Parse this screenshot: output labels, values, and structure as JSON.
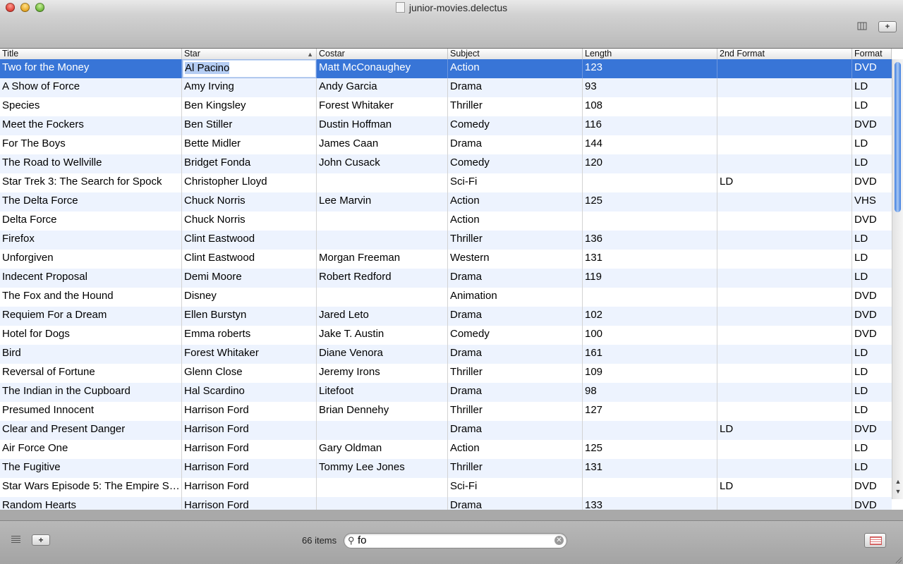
{
  "window": {
    "title": "junior-movies.delectus"
  },
  "toolbar": {
    "columns_icon": "columns-icon",
    "add_label": "+"
  },
  "table": {
    "columns": [
      "Title",
      "Star",
      "Costar",
      "Subject",
      "Length",
      "2nd Format",
      "Format"
    ],
    "sort_column": "Star",
    "sort_direction": "ascending",
    "editing_cell": {
      "row": 0,
      "column": "Star"
    },
    "rows": [
      [
        "Two for the Money",
        "Al Pacino",
        "Matt McConaughey",
        "Action",
        "123",
        "",
        "DVD"
      ],
      [
        "A Show of Force",
        "Amy Irving",
        "Andy Garcia",
        "Drama",
        "93",
        "",
        "LD"
      ],
      [
        "Species",
        "Ben Kingsley",
        "Forest Whitaker",
        "Thriller",
        "108",
        "",
        "LD"
      ],
      [
        "Meet the Fockers",
        "Ben Stiller",
        "Dustin Hoffman",
        "Comedy",
        "116",
        "",
        "DVD"
      ],
      [
        "For The Boys",
        "Bette Midler",
        "James Caan",
        "Drama",
        "144",
        "",
        "LD"
      ],
      [
        "The Road to Wellville",
        "Bridget Fonda",
        "John Cusack",
        "Comedy",
        "120",
        "",
        "LD"
      ],
      [
        "Star Trek 3: The Search for Spock",
        "Christopher Lloyd",
        "",
        "Sci-Fi",
        "",
        "LD",
        "DVD"
      ],
      [
        "The Delta Force",
        "Chuck Norris",
        "Lee Marvin",
        "Action",
        "125",
        "",
        "VHS"
      ],
      [
        "Delta Force",
        "Chuck Norris",
        "",
        "Action",
        "",
        "",
        "DVD"
      ],
      [
        "Firefox",
        "Clint Eastwood",
        "",
        "Thriller",
        "136",
        "",
        "LD"
      ],
      [
        "Unforgiven",
        "Clint Eastwood",
        "Morgan Freeman",
        "Western",
        "131",
        "",
        "LD"
      ],
      [
        "Indecent Proposal",
        "Demi Moore",
        "Robert Redford",
        "Drama",
        "119",
        "",
        "LD"
      ],
      [
        "The Fox and the Hound",
        "Disney",
        "",
        "Animation",
        "",
        "",
        "DVD"
      ],
      [
        "Requiem For a Dream",
        "Ellen Burstyn",
        "Jared Leto",
        "Drama",
        "102",
        "",
        "DVD"
      ],
      [
        "Hotel for Dogs",
        "Emma roberts",
        "Jake T. Austin",
        "Comedy",
        "100",
        "",
        "DVD"
      ],
      [
        "Bird",
        "Forest Whitaker",
        "Diane Venora",
        "Drama",
        "161",
        "",
        "LD"
      ],
      [
        "Reversal of Fortune",
        "Glenn Close",
        "Jeremy Irons",
        "Thriller",
        "109",
        "",
        "LD"
      ],
      [
        "The Indian in the Cupboard",
        "Hal Scardino",
        "Litefoot",
        "Drama",
        "98",
        "",
        "LD"
      ],
      [
        "Presumed Innocent",
        "Harrison Ford",
        "Brian Dennehy",
        "Thriller",
        "127",
        "",
        "LD"
      ],
      [
        "Clear and Present Danger",
        "Harrison Ford",
        "",
        "Drama",
        "",
        "LD",
        "DVD"
      ],
      [
        "Air Force One",
        "Harrison Ford",
        "Gary Oldman",
        "Action",
        "125",
        "",
        "LD"
      ],
      [
        "The Fugitive",
        "Harrison Ford",
        "Tommy Lee Jones",
        "Thriller",
        "131",
        "",
        "LD"
      ],
      [
        "Star Wars Episode 5: The Empire St…",
        "Harrison Ford",
        "",
        "Sci-Fi",
        "",
        "LD",
        "DVD"
      ],
      [
        "Random Hearts",
        "Harrison Ford",
        "",
        "Drama",
        "133",
        "",
        "DVD"
      ]
    ]
  },
  "footer": {
    "item_count": "66 items",
    "search_value": "fo",
    "add_label": "+"
  },
  "colors": {
    "selection": "#3875d7",
    "alt_row": "#edf3fe",
    "scroll_thumb": "#4a86e0"
  }
}
